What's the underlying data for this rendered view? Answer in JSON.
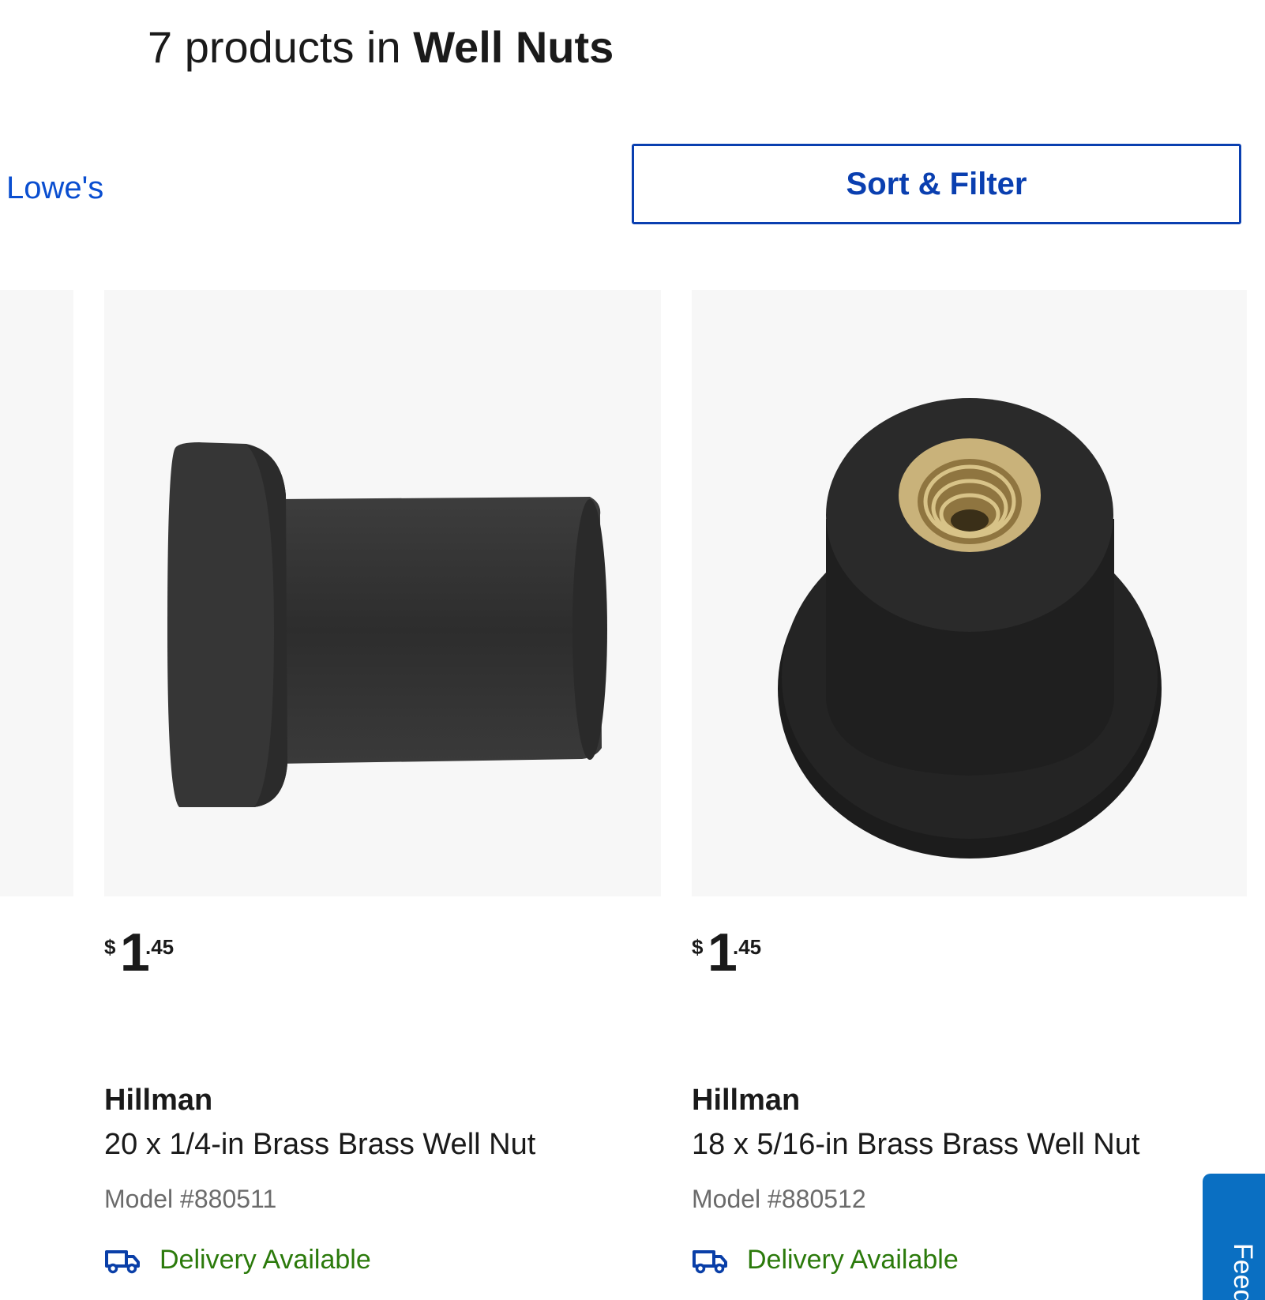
{
  "header": {
    "count_text": "7 products in",
    "category": "Well Nuts"
  },
  "breadcrumb": {
    "link_label": "Lowe's"
  },
  "toolbar": {
    "sort_filter_label": "Sort & Filter"
  },
  "products": [
    {
      "price_symbol": "$",
      "price_whole": "1",
      "price_cents": ".45",
      "brand": "Hillman",
      "title": "20 x 1/4-in Brass Brass Well Nut",
      "model": "Model #880511",
      "delivery": "Delivery Available"
    },
    {
      "price_symbol": "$",
      "price_whole": "1",
      "price_cents": ".45",
      "brand": "Hillman",
      "title": "18 x 5/16-in Brass Brass Well Nut",
      "model": "Model #880512",
      "delivery": "Delivery Available"
    }
  ],
  "feedback": {
    "label": "Feedback"
  },
  "colors": {
    "link_blue": "#0a4ed0",
    "button_border": "#0a3fb0",
    "delivery_green": "#2b7a0b",
    "feedback_blue": "#0a6fc2"
  },
  "icons": [
    "truck-icon"
  ]
}
